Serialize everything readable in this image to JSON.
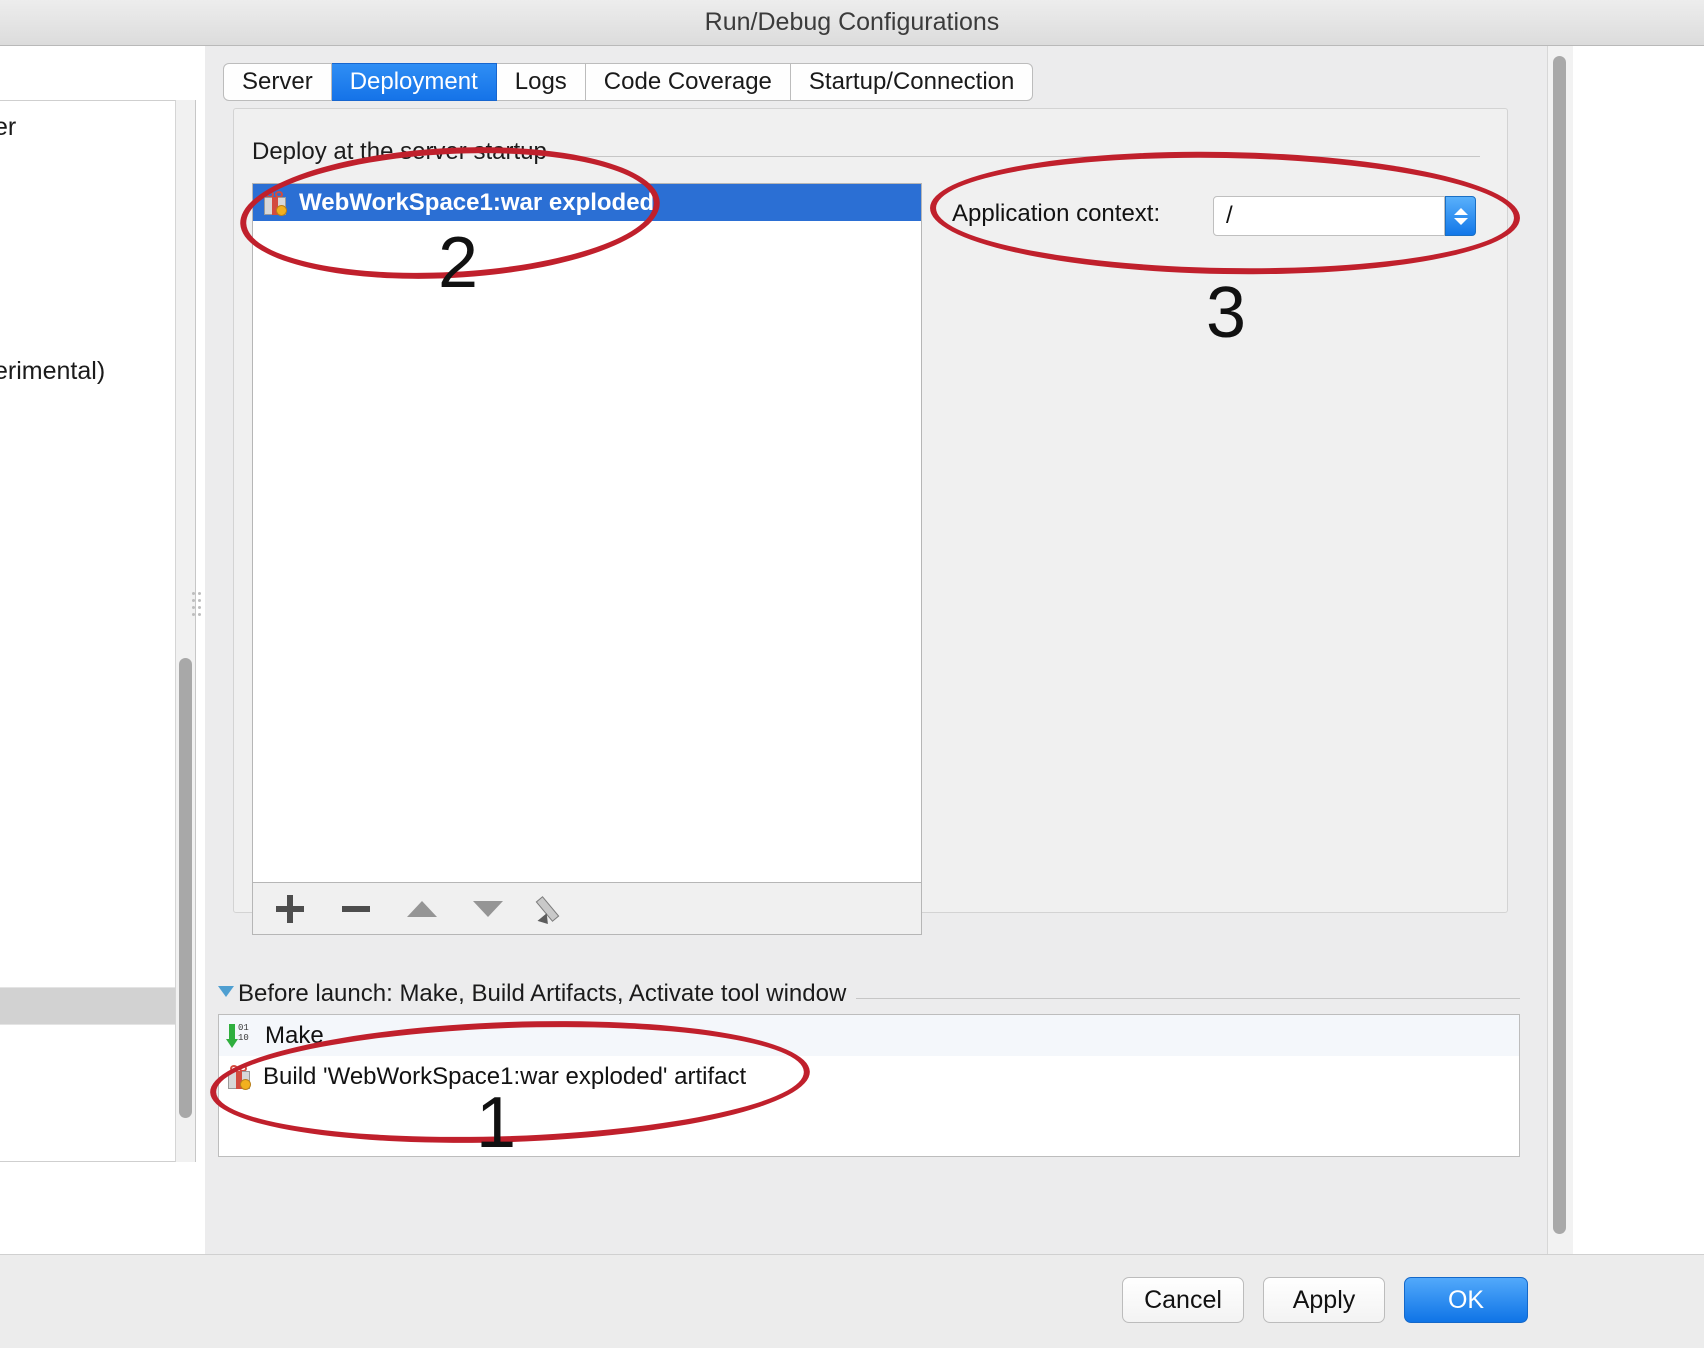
{
  "window": {
    "title": "Run/Debug Configurations"
  },
  "tabs": [
    {
      "label": "Server",
      "active": false
    },
    {
      "label": "Deployment",
      "active": true
    },
    {
      "label": "Logs",
      "active": false
    },
    {
      "label": "Code Coverage",
      "active": false
    },
    {
      "label": "Startup/Connection",
      "active": false
    }
  ],
  "left_panel": {
    "fragment_top": "er",
    "fragment_bottom": "erimental)"
  },
  "deployment": {
    "section_label": "Deploy at the server startup",
    "list": [
      {
        "label": "WebWorkSpace1:war exploded",
        "icon": "artifact-icon",
        "selected": true
      }
    ],
    "toolbar": [
      {
        "name": "add",
        "icon": "plus-icon"
      },
      {
        "name": "remove",
        "icon": "minus-icon"
      },
      {
        "name": "move-up",
        "icon": "triangle-up-icon"
      },
      {
        "name": "move-down",
        "icon": "triangle-down-icon"
      },
      {
        "name": "edit",
        "icon": "pencil-icon"
      }
    ],
    "application_context": {
      "label": "Application context:",
      "value": "/",
      "placeholder": "/"
    }
  },
  "before_launch": {
    "header": "Before launch: Make, Build Artifacts, Activate tool window",
    "rows": [
      {
        "label": "Make",
        "icon": "make-icon"
      },
      {
        "label": "Build 'WebWorkSpace1:war exploded' artifact",
        "icon": "artifact-icon"
      }
    ]
  },
  "footer": {
    "cancel": "Cancel",
    "apply": "Apply",
    "ok": "OK"
  },
  "annotations": [
    {
      "number": "2",
      "target": "deploy-list-item"
    },
    {
      "number": "3",
      "target": "application-context-field"
    },
    {
      "number": "1",
      "target": "before-launch-rows"
    }
  ],
  "colors": {
    "accent_blue": "#2b6fd4",
    "tab_active": "#1573e8",
    "annotation_red": "#c0202c",
    "dialog_bg": "#ececed"
  }
}
